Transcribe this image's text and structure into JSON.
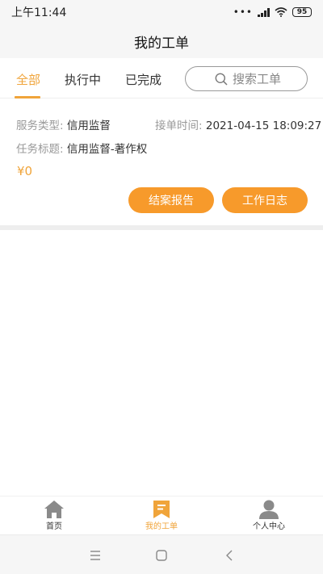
{
  "status": {
    "time": "上午11:44",
    "dots": "•••",
    "battery": "95"
  },
  "header": {
    "title": "我的工单"
  },
  "tabs": [
    {
      "label": "全部"
    },
    {
      "label": "执行中"
    },
    {
      "label": "已完成"
    }
  ],
  "search": {
    "placeholder": "搜索工单"
  },
  "order": {
    "service_type_label": "服务类型:",
    "service_type_value": "信用监督",
    "accept_time_label": "接单时间:",
    "accept_time_value": "2021-04-15 18:09:27",
    "task_title_label": "任务标题:",
    "task_title_value": "信用监督-著作权",
    "price": "¥0",
    "report_button": "结案报告",
    "log_button": "工作日志"
  },
  "bottom_nav": {
    "home": "首页",
    "my_orders": "我的工单",
    "profile": "个人中心"
  },
  "colors": {
    "accent": "#f0a43a",
    "button": "#f79a2b"
  }
}
